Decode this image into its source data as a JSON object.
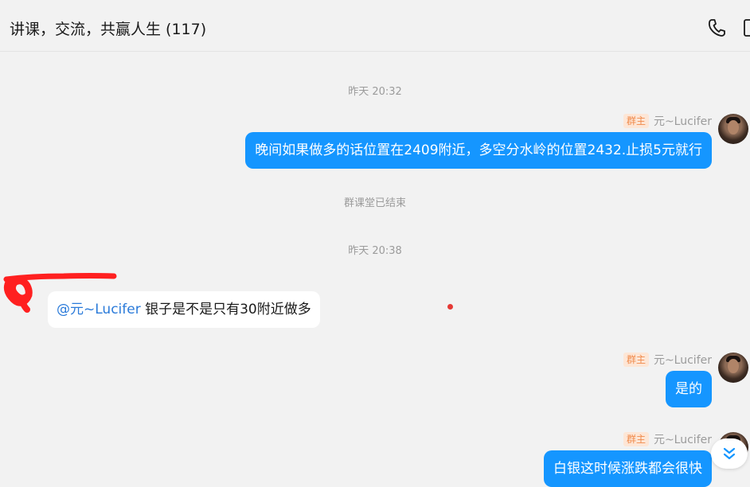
{
  "header": {
    "title": "讲课，交流，共赢人生 (117)",
    "icons": [
      "phone-icon",
      "more-icon"
    ]
  },
  "messages": [
    {
      "type": "time",
      "text": "昨天 20:32"
    },
    {
      "type": "outgoing",
      "badge": "群主",
      "sender": "元~Lucifer",
      "text": "晚间如果做多的话位置在2409附近，多空分水岭的位置2432.止损5元就行"
    },
    {
      "type": "system",
      "text": "群课堂已结束"
    },
    {
      "type": "time",
      "text": "昨天 20:38"
    },
    {
      "type": "incoming",
      "mention": "@元~Lucifer",
      "text": " 银子是不是只有30附近做多"
    },
    {
      "type": "outgoing",
      "badge": "群主",
      "sender": "元~Lucifer",
      "text": "是的"
    },
    {
      "type": "outgoing",
      "badge": "群主",
      "sender": "元~Lucifer",
      "text": "白银这时候涨跌都会很快"
    }
  ],
  "colors": {
    "bubble_out": "#1596ff",
    "bubble_in": "#ffffff",
    "mention": "#2a7ad9",
    "badge_bg": "#fde6d6",
    "badge_text": "#f08a4b",
    "background": "#f2f2f2"
  }
}
